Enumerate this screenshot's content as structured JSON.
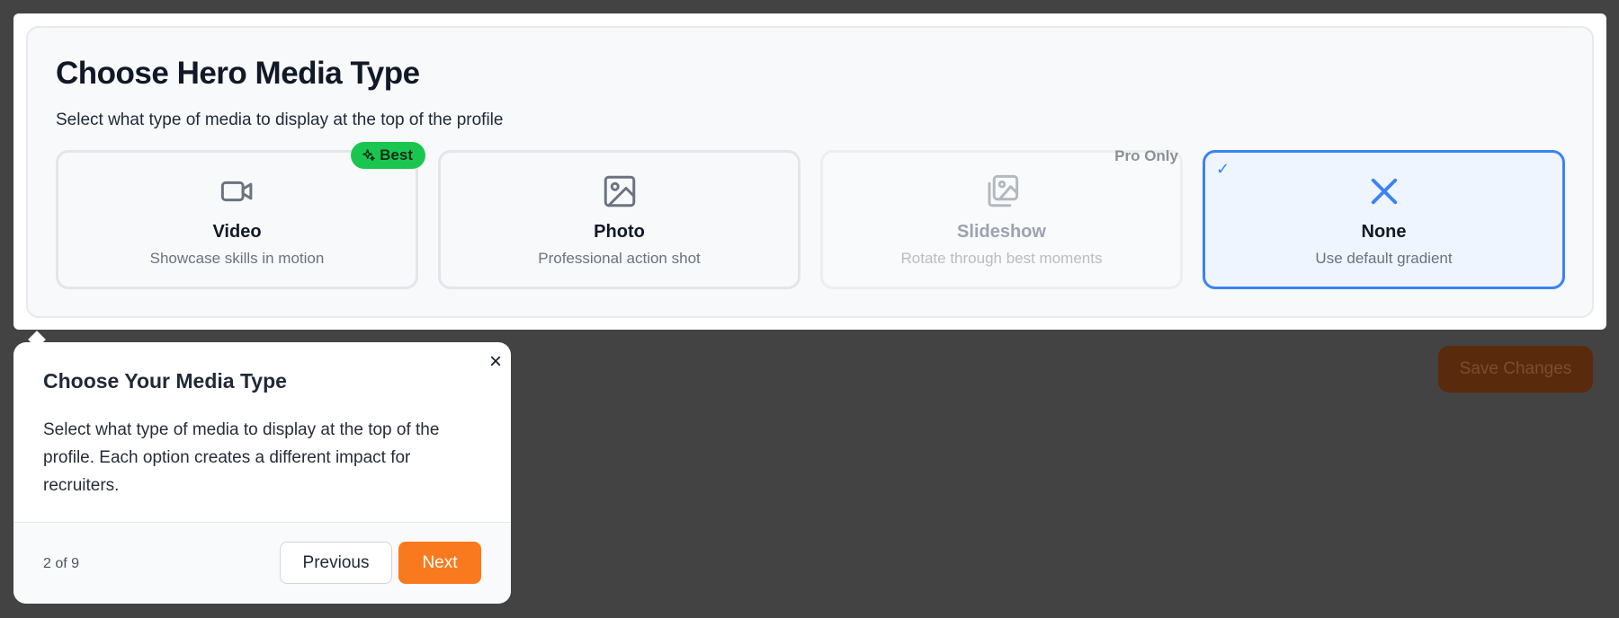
{
  "header": {
    "title": "Choose Hero Media Type",
    "subtitle": "Select what type of media to display at the top of the profile"
  },
  "options": [
    {
      "title": "Video",
      "desc": "Showcase skills in motion",
      "icon": "video-camera-icon",
      "badge": "Best",
      "badge_color": "#1bc650"
    },
    {
      "title": "Photo",
      "desc": "Professional action shot",
      "icon": "image-icon"
    },
    {
      "title": "Slideshow",
      "desc": "Rotate through best moments",
      "icon": "images-icon",
      "badge": "Pro Only",
      "disabled": true
    },
    {
      "title": "None",
      "desc": "Use default gradient",
      "icon": "close-x-icon",
      "selected": true,
      "check": "✓",
      "accent": "#3b82f6"
    }
  ],
  "save_button": {
    "label": "Save Changes"
  },
  "tour": {
    "close": "×",
    "title": "Choose Your Media Type",
    "body": "Select what type of media to display at the top of the profile. Each option creates a different impact for recruiters.",
    "step": "2 of 9",
    "prev_label": "Previous",
    "next_label": "Next",
    "next_color": "#f97a1e"
  }
}
